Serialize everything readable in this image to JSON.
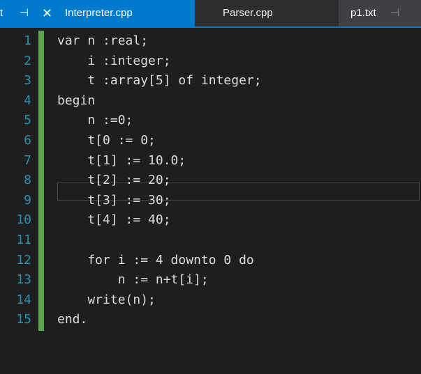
{
  "tabs": {
    "active": {
      "partial_label": "t",
      "pin_glyph": "⊣",
      "close_glyph": "✕",
      "label": "Interpreter.cpp",
      "pin_icon": "pin-icon",
      "close_icon": "close-icon"
    },
    "parser": {
      "label": "Parser.cpp"
    },
    "p1": {
      "label": "p1.txt",
      "pin_glyph": "⊣",
      "pin_icon": "pin-icon"
    }
  },
  "editor": {
    "current_line": 8,
    "lines": [
      {
        "num": "1",
        "text": "var n :real;"
      },
      {
        "num": "2",
        "text": "    i :integer;"
      },
      {
        "num": "3",
        "text": "    t :array[5] of integer;"
      },
      {
        "num": "4",
        "text": "begin"
      },
      {
        "num": "5",
        "text": "    n :=0;"
      },
      {
        "num": "6",
        "text": "    t[0 := 0;"
      },
      {
        "num": "7",
        "text": "    t[1] := 10.0;"
      },
      {
        "num": "8",
        "text": "    t[2] := 20;"
      },
      {
        "num": "9",
        "text": "    t[3] := 30;"
      },
      {
        "num": "10",
        "text": "    t[4] := 40;"
      },
      {
        "num": "11",
        "text": ""
      },
      {
        "num": "12",
        "text": "    for i := 4 downto 0 do"
      },
      {
        "num": "13",
        "text": "        n := n+t[i];"
      },
      {
        "num": "14",
        "text": "    write(n);"
      },
      {
        "num": "15",
        "text": "end."
      }
    ]
  }
}
